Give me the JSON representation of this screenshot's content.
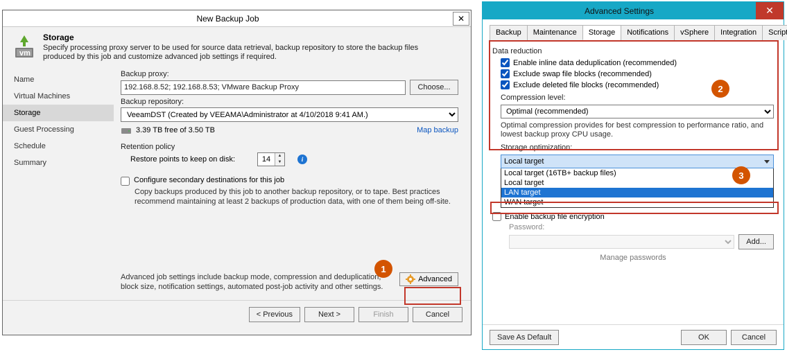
{
  "dlgLeft": {
    "title": "New Backup Job",
    "header": {
      "title": "Storage",
      "subtitle": "Specify processing proxy server to be used for source data retrieval, backup repository to store the backup files produced by this job and customize advanced job settings if required."
    },
    "nav": [
      "Name",
      "Virtual Machines",
      "Storage",
      "Guest Processing",
      "Schedule",
      "Summary"
    ],
    "nav_active": 2,
    "proxy_label": "Backup proxy:",
    "proxy_value": "192.168.8.52; 192.168.8.53; VMware Backup Proxy",
    "choose_label": "Choose...",
    "repo_label": "Backup repository:",
    "repo_value": "VeeamDST (Created by VEEAMA\\Administrator at 4/10/2018 9:41 AM.)",
    "free_space": "3.39 TB free of 3.50 TB",
    "map_backup": "Map backup",
    "retention_label": "Retention policy",
    "restore_points_label": "Restore points to keep on disk:",
    "restore_points_value": "14",
    "secondary_chk": "Configure secondary destinations for this job",
    "secondary_desc": "Copy backups produced by this job to another backup repository, or to tape. Best practices recommend maintaining at least 2 backups of production data, with one of them being off-site.",
    "adv_text": "Advanced job settings include backup mode, compression and deduplication, block size, notification settings, automated post-job activity and other settings.",
    "adv_btn": "Advanced",
    "footer": {
      "prev": "< Previous",
      "next": "Next >",
      "finish": "Finish",
      "cancel": "Cancel"
    }
  },
  "dlgRight": {
    "title": "Advanced Settings",
    "tabs": [
      "Backup",
      "Maintenance",
      "Storage",
      "Notifications",
      "vSphere",
      "Integration",
      "Scripts"
    ],
    "tabs_active": 2,
    "data_reduction": "Data reduction",
    "chk_dedup": "Enable inline data deduplication (recommended)",
    "chk_swap": "Exclude swap file blocks (recommended)",
    "chk_deleted": "Exclude deleted file blocks (recommended)",
    "comp_label": "Compression level:",
    "comp_value": "Optimal (recommended)",
    "comp_hint": "Optimal compression provides for best compression to performance ratio, and lowest backup proxy CPU usage.",
    "storage_opt_label": "Storage optimization:",
    "storage_opt_selected": "Local target",
    "storage_opt_options": [
      "Local target (16TB+ backup files)",
      "Local target",
      "LAN target",
      "WAN target"
    ],
    "encrypt_chk": "Enable backup file encryption",
    "pw_label": "Password:",
    "add_btn": "Add...",
    "manage_pw": "Manage passwords",
    "footer": {
      "save_default": "Save As Default",
      "ok": "OK",
      "cancel": "Cancel"
    }
  },
  "callouts": {
    "1": "1",
    "2": "2",
    "3": "3"
  }
}
